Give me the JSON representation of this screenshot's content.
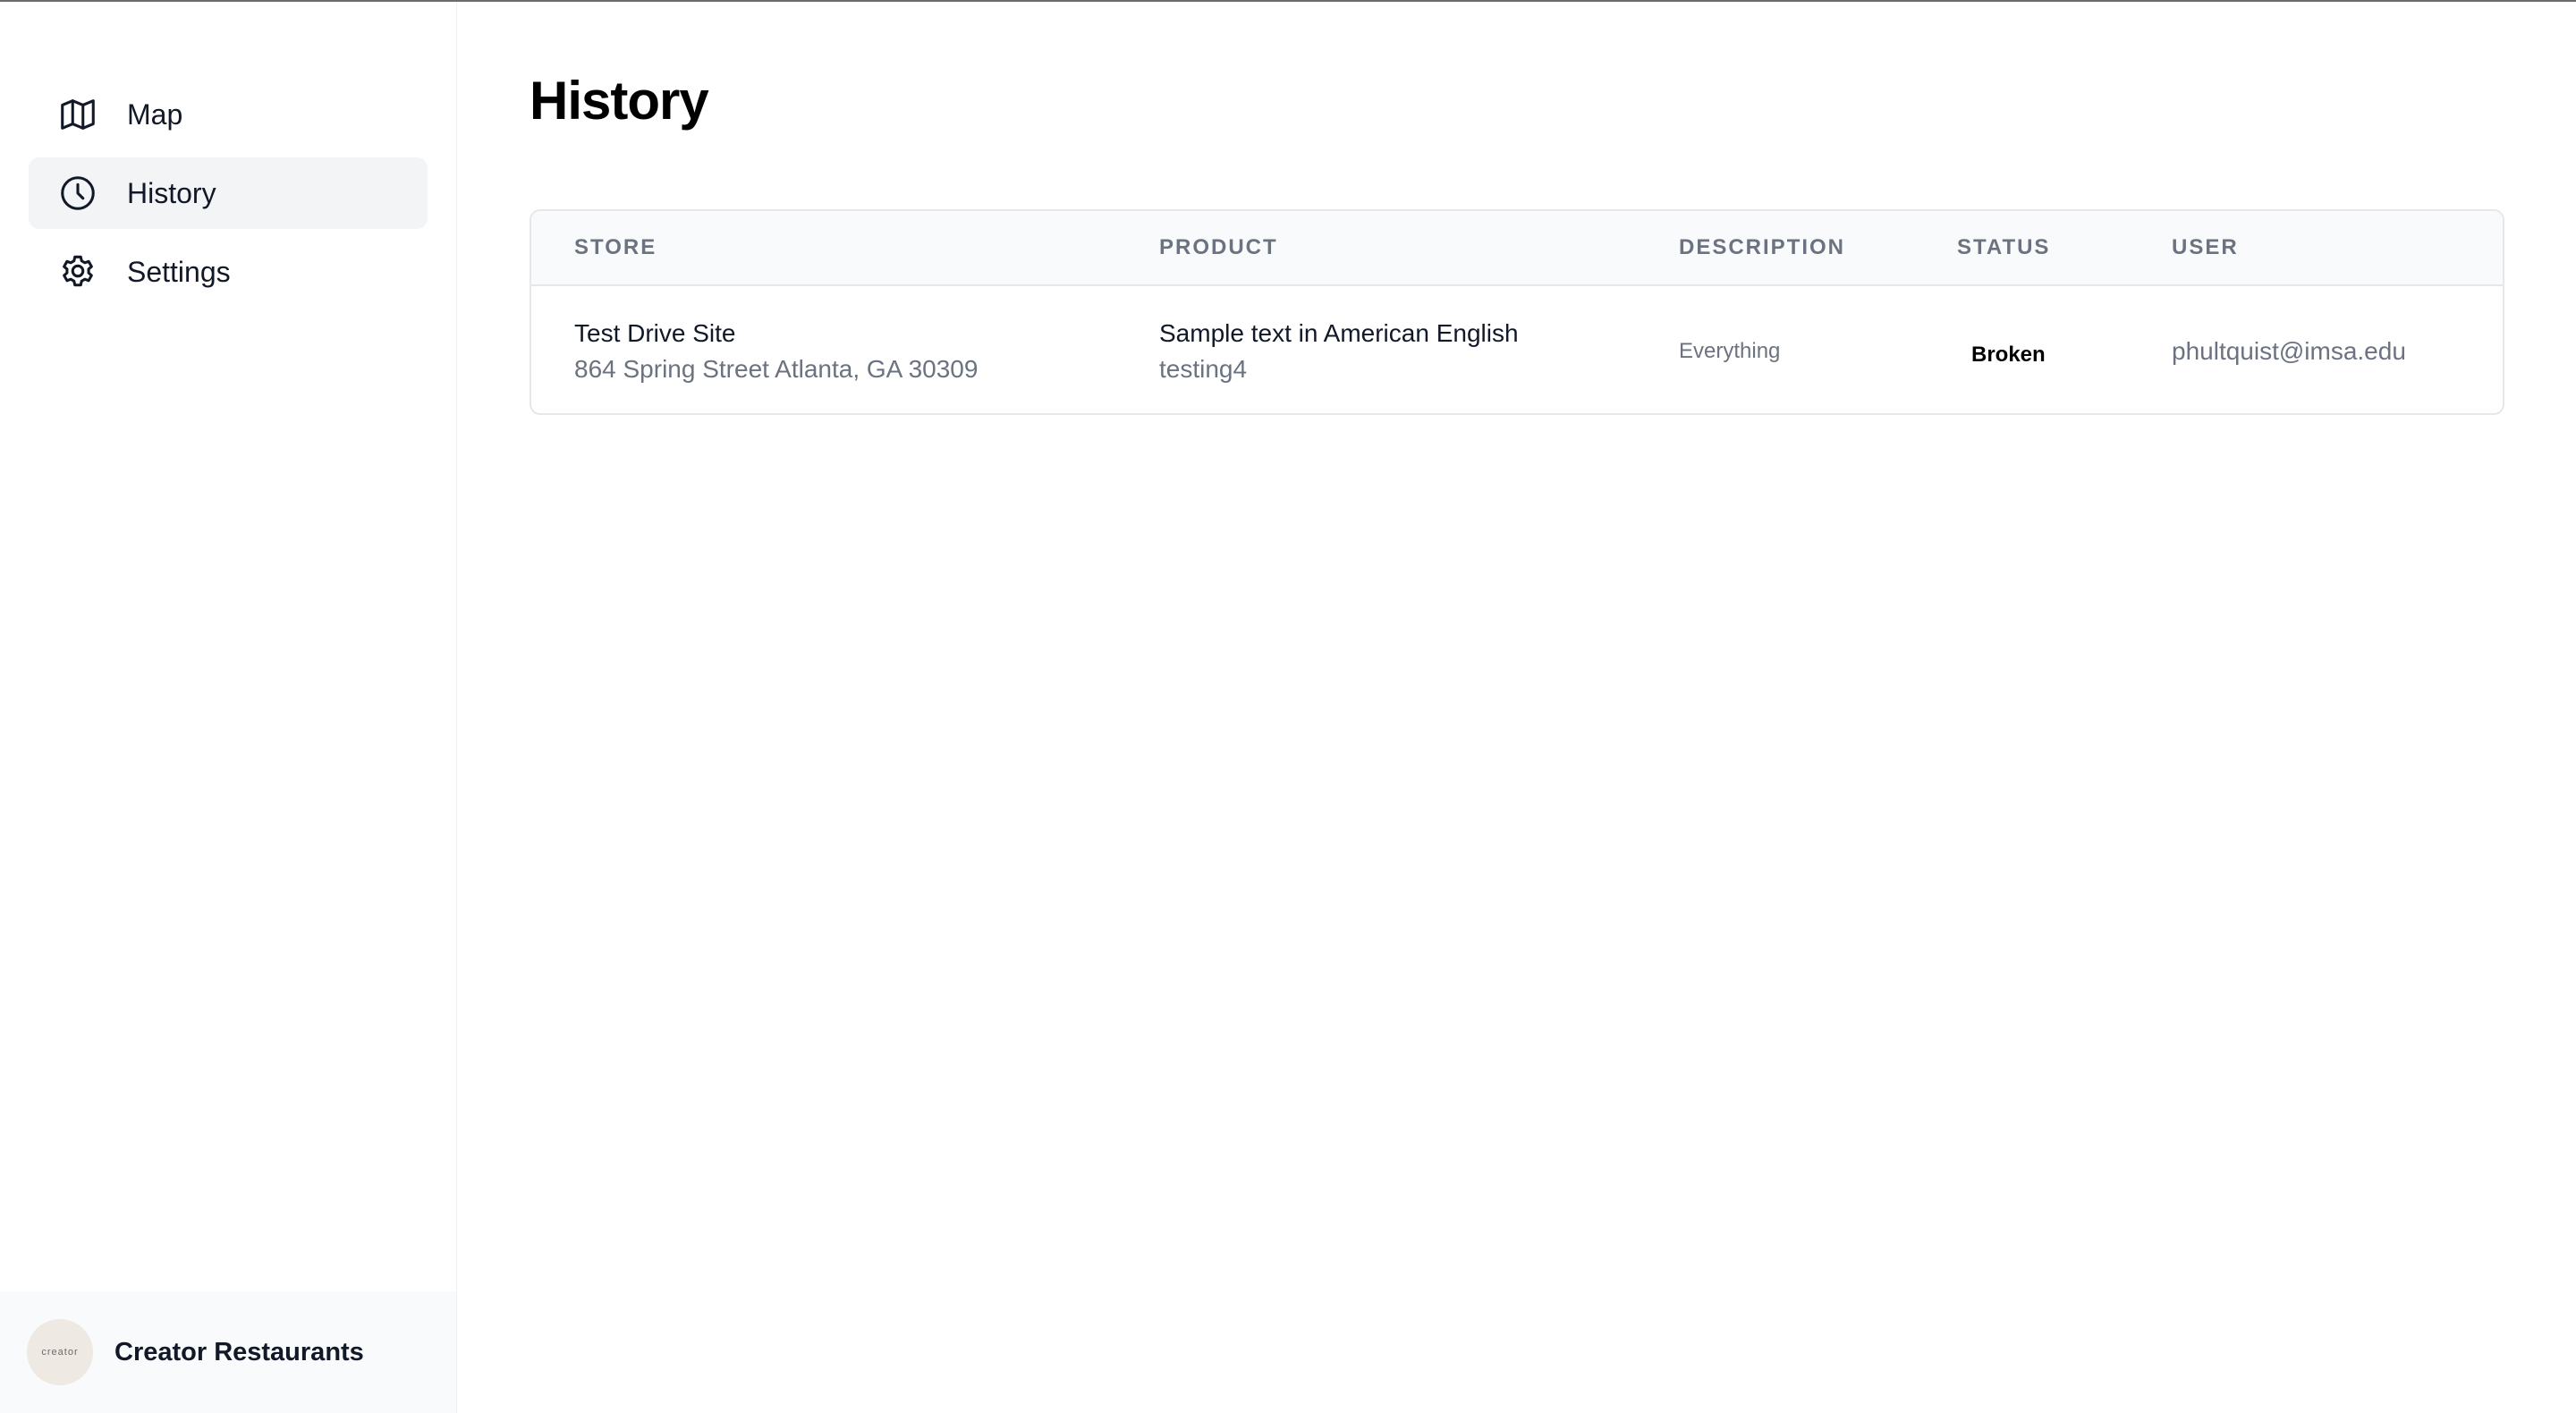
{
  "sidebar": {
    "items": [
      {
        "label": "Map",
        "icon": "map-icon",
        "active": false
      },
      {
        "label": "History",
        "icon": "clock-icon",
        "active": true
      },
      {
        "label": "Settings",
        "icon": "gear-icon",
        "active": false
      }
    ],
    "footer": {
      "avatar_text": "creator",
      "org_name": "Creator Restaurants"
    }
  },
  "main": {
    "title": "History",
    "table": {
      "headers": {
        "store": "STORE",
        "product": "PRODUCT",
        "description": "DESCRIPTION",
        "status": "STATUS",
        "user": "USER"
      },
      "rows": [
        {
          "store_name": "Test Drive Site",
          "store_address": "864 Spring Street Atlanta, GA 30309",
          "product_name": "Sample text in American English",
          "product_id": "testing4",
          "description": "Everything",
          "status": "Broken",
          "user": "phultquist@imsa.edu"
        }
      ]
    }
  },
  "colors": {
    "active_nav_bg": "#f3f4f6",
    "table_header_bg": "#f9fafb",
    "border": "#e5e7eb",
    "muted_text": "#6b7280"
  }
}
